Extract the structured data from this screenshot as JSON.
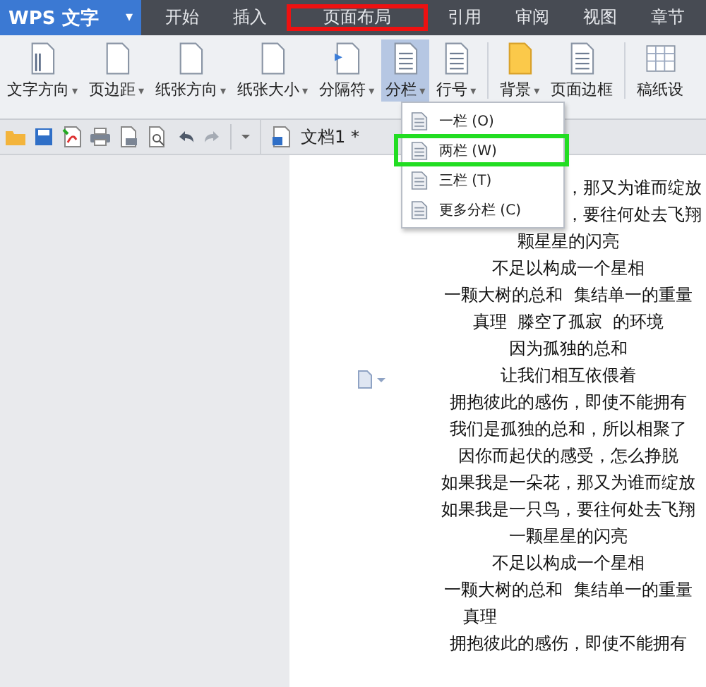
{
  "app": {
    "name": "WPS 文字",
    "menu_caret": "▾"
  },
  "tabs": [
    {
      "label": "开始",
      "selected": false
    },
    {
      "label": "插入",
      "selected": false
    },
    {
      "label": "页面布局",
      "selected": true
    },
    {
      "label": "引用",
      "selected": false
    },
    {
      "label": "审阅",
      "selected": false
    },
    {
      "label": "视图",
      "selected": false
    },
    {
      "label": "章节",
      "selected": false
    }
  ],
  "ribbon_groups": [
    [
      {
        "label": "文字方向",
        "caret": "▾",
        "pressed": false
      },
      {
        "label": "页边距",
        "caret": "▾",
        "pressed": false
      },
      {
        "label": "纸张方向",
        "caret": "▾",
        "pressed": false
      },
      {
        "label": "纸张大小",
        "caret": "▾",
        "pressed": false
      },
      {
        "label": "分隔符",
        "caret": "▾",
        "pressed": false
      },
      {
        "label": "分栏",
        "caret": "▾",
        "pressed": true
      },
      {
        "label": "行号",
        "caret": "▾",
        "pressed": false
      }
    ],
    [
      {
        "label": "背景",
        "caret": "▾",
        "pressed": false
      },
      {
        "label": "页面边框",
        "pressed": false
      }
    ],
    [
      {
        "label": "稿纸设",
        "pressed": false
      }
    ]
  ],
  "document_tab": {
    "title": "文档1 *"
  },
  "column_menu": [
    {
      "label": "一栏 (O)",
      "selected": false
    },
    {
      "label": "两栏 (W)",
      "selected": true
    },
    {
      "label": "三栏 (T)",
      "selected": false
    },
    {
      "label": "更多分栏 (C)",
      "selected": false
    }
  ],
  "document_lines": [
    {
      "text": "，那又为谁而绽放",
      "kind": "tail"
    },
    {
      "text": "，要往何处去飞翔",
      "kind": "tail"
    },
    {
      "text": "颗星星的闪亮",
      "kind": "line"
    },
    {
      "text": "不足以构成一个星相",
      "kind": "line"
    },
    {
      "text": "一颗大树的总和  集结单一的重量",
      "kind": "line"
    },
    {
      "text": "真理  滕空了孤寂  的环境",
      "kind": "line"
    },
    {
      "text": "因为孤独的总和",
      "kind": "line"
    },
    {
      "text": "让我们相互依偎着",
      "kind": "line"
    },
    {
      "text": "拥抱彼此的感伤，即使不能拥有",
      "kind": "line"
    },
    {
      "text": "我们是孤独的总和，所以相聚了",
      "kind": "line"
    },
    {
      "text": "因你而起伏的感受，怎么挣脱",
      "kind": "line"
    },
    {
      "text": "如果我是一朵花，那又为谁而绽放",
      "kind": "line"
    },
    {
      "text": "如果我是一只鸟，要往何处去飞翔",
      "kind": "line"
    },
    {
      "text": "一颗星星的闪亮",
      "kind": "line"
    },
    {
      "text": "不足以构成一个星相",
      "kind": "line"
    },
    {
      "text": "一颗大树的总和  集结单一的重量",
      "kind": "line"
    },
    {
      "text": "真理",
      "kind": "head"
    },
    {
      "text": "拥抱彼此的感伤，即使不能拥有",
      "kind": "line"
    }
  ]
}
